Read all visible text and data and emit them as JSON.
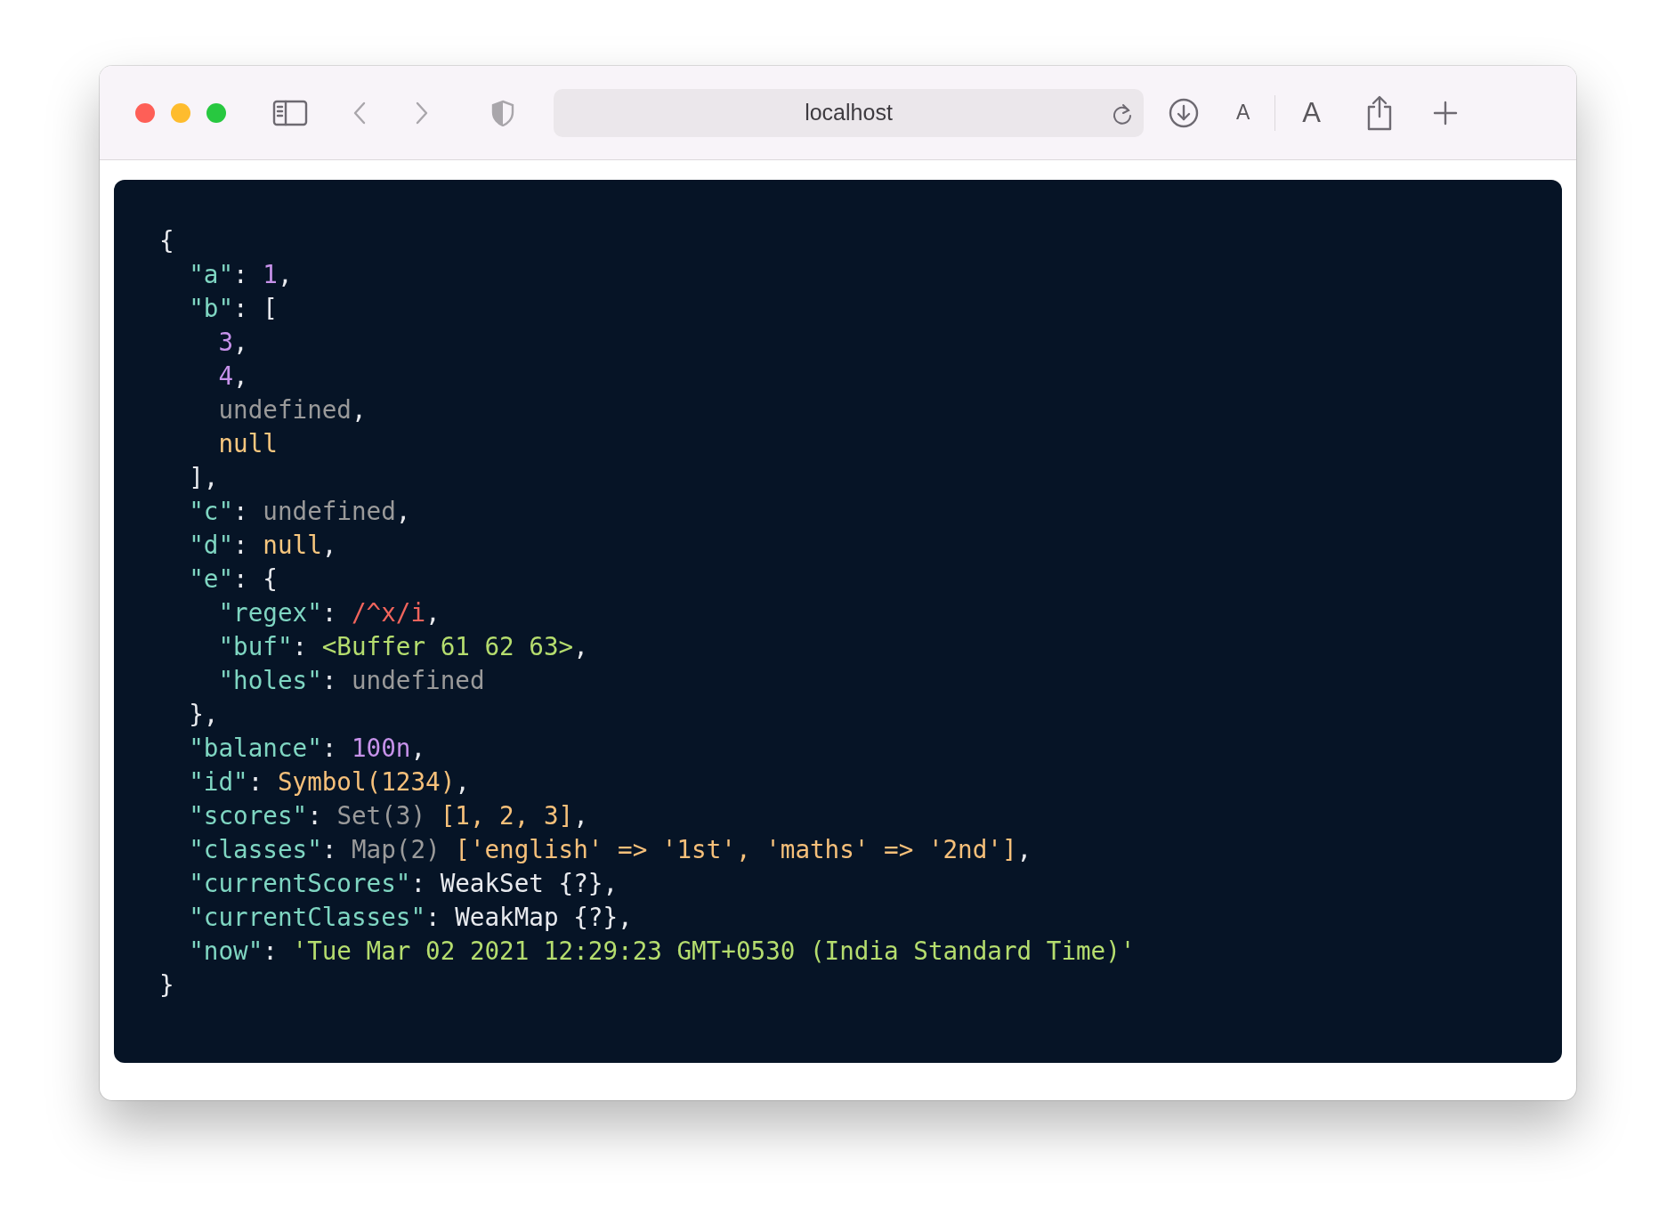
{
  "toolbar": {
    "address": "localhost",
    "text_size_small": "A",
    "text_size_large": "A"
  },
  "code": {
    "lines": [
      [
        {
          "text": "{",
          "kind": "punct"
        }
      ],
      [
        {
          "text": "  \"a\"",
          "kind": "key"
        },
        {
          "text": ": ",
          "kind": "punct"
        },
        {
          "text": "1",
          "kind": "number"
        },
        {
          "text": ",",
          "kind": "punct"
        }
      ],
      [
        {
          "text": "  \"b\"",
          "kind": "key"
        },
        {
          "text": ": [",
          "kind": "punct"
        }
      ],
      [
        {
          "text": "    3",
          "kind": "number"
        },
        {
          "text": ",",
          "kind": "punct"
        }
      ],
      [
        {
          "text": "    4",
          "kind": "number"
        },
        {
          "text": ",",
          "kind": "punct"
        }
      ],
      [
        {
          "text": "    undefined",
          "kind": "undefined"
        },
        {
          "text": ",",
          "kind": "punct"
        }
      ],
      [
        {
          "text": "    null",
          "kind": "null"
        }
      ],
      [
        {
          "text": "  ],",
          "kind": "punct"
        }
      ],
      [
        {
          "text": "  \"c\"",
          "kind": "key"
        },
        {
          "text": ": ",
          "kind": "punct"
        },
        {
          "text": "undefined",
          "kind": "undefined"
        },
        {
          "text": ",",
          "kind": "punct"
        }
      ],
      [
        {
          "text": "  \"d\"",
          "kind": "key"
        },
        {
          "text": ": ",
          "kind": "punct"
        },
        {
          "text": "null",
          "kind": "null"
        },
        {
          "text": ",",
          "kind": "punct"
        }
      ],
      [
        {
          "text": "  \"e\"",
          "kind": "key"
        },
        {
          "text": ": {",
          "kind": "punct"
        }
      ],
      [
        {
          "text": "    \"regex\"",
          "kind": "key"
        },
        {
          "text": ": ",
          "kind": "punct"
        },
        {
          "text": "/^x/i",
          "kind": "regex"
        },
        {
          "text": ",",
          "kind": "punct"
        }
      ],
      [
        {
          "text": "    \"buf\"",
          "kind": "key"
        },
        {
          "text": ": ",
          "kind": "punct"
        },
        {
          "text": "<Buffer 61 62 63>",
          "kind": "string"
        },
        {
          "text": ",",
          "kind": "punct"
        }
      ],
      [
        {
          "text": "    \"holes\"",
          "kind": "key"
        },
        {
          "text": ": ",
          "kind": "punct"
        },
        {
          "text": "undefined",
          "kind": "undefined"
        }
      ],
      [
        {
          "text": "  },",
          "kind": "punct"
        }
      ],
      [
        {
          "text": "  \"balance\"",
          "kind": "key"
        },
        {
          "text": ": ",
          "kind": "punct"
        },
        {
          "text": "100n",
          "kind": "number"
        },
        {
          "text": ",",
          "kind": "punct"
        }
      ],
      [
        {
          "text": "  \"id\"",
          "kind": "key"
        },
        {
          "text": ": ",
          "kind": "punct"
        },
        {
          "text": "Symbol(1234)",
          "kind": "symbol"
        },
        {
          "text": ",",
          "kind": "punct"
        }
      ],
      [
        {
          "text": "  \"scores\"",
          "kind": "key"
        },
        {
          "text": ": ",
          "kind": "punct"
        },
        {
          "text": "Set(3) ",
          "kind": "undefined"
        },
        {
          "text": "[1, 2, 3]",
          "kind": "symbol"
        },
        {
          "text": ",",
          "kind": "punct"
        }
      ],
      [
        {
          "text": "  \"classes\"",
          "kind": "key"
        },
        {
          "text": ": ",
          "kind": "punct"
        },
        {
          "text": "Map(2) ",
          "kind": "undefined"
        },
        {
          "text": "['english' => '1st', 'maths' => '2nd']",
          "kind": "symbol"
        },
        {
          "text": ",",
          "kind": "punct"
        }
      ],
      [
        {
          "text": "  \"currentScores\"",
          "kind": "key"
        },
        {
          "text": ": WeakSet {?},",
          "kind": "punct"
        }
      ],
      [
        {
          "text": "  \"currentClasses\"",
          "kind": "key"
        },
        {
          "text": ": WeakMap {?},",
          "kind": "punct"
        }
      ],
      [
        {
          "text": "  \"now\"",
          "kind": "key"
        },
        {
          "text": ": ",
          "kind": "punct"
        },
        {
          "text": "'Tue Mar 02 2021 12:29:23 GMT+0530 (India Standard Time)'",
          "kind": "string"
        }
      ],
      [
        {
          "text": "}",
          "kind": "punct"
        }
      ]
    ]
  }
}
